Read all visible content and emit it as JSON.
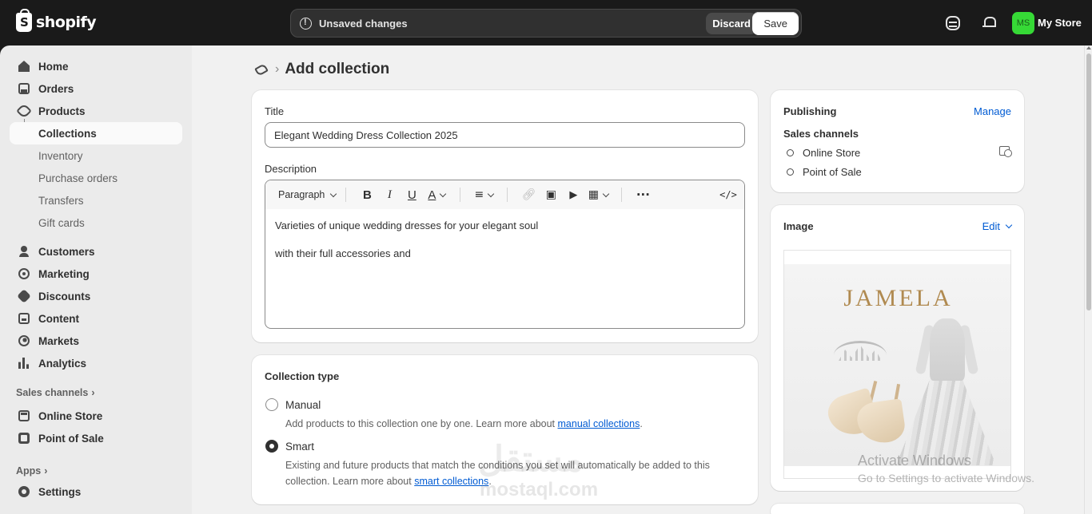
{
  "brand": {
    "name": "shopify"
  },
  "topbar": {
    "unsaved_text": "Unsaved changes",
    "discard_label": "Discard",
    "save_label": "Save",
    "avatar_initials": "MS",
    "store_name": "My Store"
  },
  "sidebar": {
    "items": [
      {
        "label": "Home",
        "icon": "home-icon"
      },
      {
        "label": "Orders",
        "icon": "orders-icon"
      },
      {
        "label": "Products",
        "icon": "tag-icon"
      },
      {
        "label": "Collections",
        "active": true
      },
      {
        "label": "Inventory"
      },
      {
        "label": "Purchase orders"
      },
      {
        "label": "Transfers"
      },
      {
        "label": "Gift cards"
      },
      {
        "label": "Customers",
        "icon": "person-icon"
      },
      {
        "label": "Marketing",
        "icon": "target-icon"
      },
      {
        "label": "Discounts",
        "icon": "discount-icon"
      },
      {
        "label": "Content",
        "icon": "content-icon"
      },
      {
        "label": "Markets",
        "icon": "globe-icon"
      },
      {
        "label": "Analytics",
        "icon": "bar-chart-icon"
      }
    ],
    "sales_channels_label": "Sales channels",
    "channels": [
      {
        "label": "Online Store",
        "icon": "store-icon"
      },
      {
        "label": "Point of Sale",
        "icon": "pos-icon"
      }
    ],
    "apps_label": "Apps",
    "settings_label": "Settings"
  },
  "page": {
    "title": "Add collection"
  },
  "form": {
    "title_label": "Title",
    "title_value": "Elegant Wedding Dress Collection 2025",
    "description_label": "Description",
    "paragraph_select": "Paragraph",
    "description_lines": [
      "Varieties of unique wedding dresses for your elegant soul",
      "with their full accessories and"
    ]
  },
  "collection_type": {
    "heading": "Collection type",
    "selected": "Smart",
    "manual": {
      "label": "Manual",
      "help_prefix": "Add products to this collection one by one. Learn more about ",
      "help_link": "manual collections",
      "help_suffix": "."
    },
    "smart": {
      "label": "Smart",
      "help_prefix": "Existing and future products that match the conditions you set will automatically be added to this collection. Learn more about ",
      "help_link": "smart collections",
      "help_suffix": "."
    }
  },
  "publishing": {
    "heading": "Publishing",
    "manage_label": "Manage",
    "sales_channels_label": "Sales channels",
    "channels": [
      "Online Store",
      "Point of Sale"
    ]
  },
  "image_card": {
    "heading": "Image",
    "edit_label": "Edit",
    "brand_text": "JAMELA"
  },
  "overlay": {
    "activate_title": "Activate Windows",
    "activate_sub": "Go to Settings to activate Windows.",
    "watermark": "مستقل",
    "watermark_sub": "mostaql.com"
  },
  "colors": {
    "topbar": "#1a1a1a",
    "sidebar": "#ebebeb",
    "main_bg": "#f1f1f1",
    "link": "#005bd3",
    "avatar": "#36d936"
  }
}
